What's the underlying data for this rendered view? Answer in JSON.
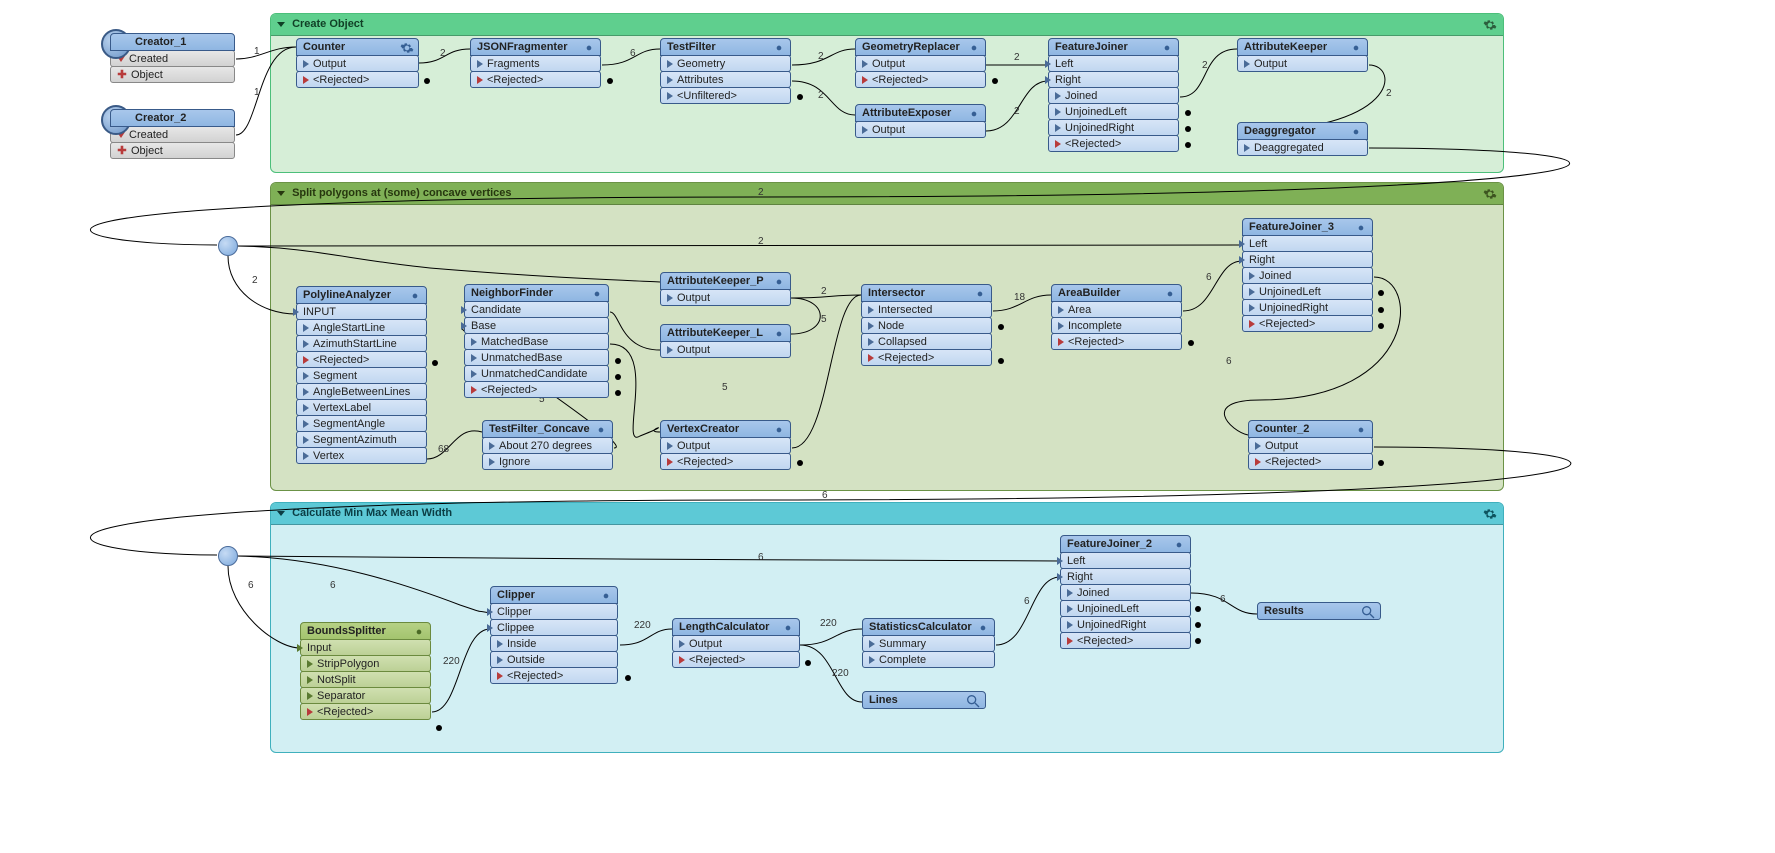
{
  "bookmarks": {
    "create": {
      "title": "Create Object"
    },
    "split": {
      "title": "Split polygons at (some) concave vertices"
    },
    "calc": {
      "title": "Calculate Min Max Mean Width"
    }
  },
  "readers": {
    "c1": {
      "name": "Creator_1",
      "p1": "Created",
      "p2": "Object"
    },
    "c2": {
      "name": "Creator_2",
      "p1": "Created",
      "p2": "Object"
    }
  },
  "nodes": {
    "counter": {
      "title": "Counter",
      "ports": [
        "Output",
        "<Rejected>"
      ]
    },
    "jsonfrag": {
      "title": "JSONFragmenter",
      "ports": [
        "Fragments",
        "<Rejected>"
      ]
    },
    "testfilter": {
      "title": "TestFilter",
      "ports": [
        "Geometry",
        "Attributes",
        "<Unfiltered>"
      ]
    },
    "georeplacer": {
      "title": "GeometryReplacer",
      "ports": [
        "Output",
        "<Rejected>"
      ]
    },
    "attrexposer": {
      "title": "AttributeExposer",
      "ports": [
        "Output"
      ]
    },
    "fjoin": {
      "title": "FeatureJoiner",
      "inports": [
        "Left",
        "Right"
      ],
      "ports": [
        "Joined",
        "UnjoinedLeft",
        "UnjoinedRight",
        "<Rejected>"
      ]
    },
    "attrkeeper": {
      "title": "AttributeKeeper",
      "ports": [
        "Output"
      ]
    },
    "deagg": {
      "title": "Deaggregator",
      "ports": [
        "Deaggregated"
      ]
    },
    "polyline": {
      "title": "PolylineAnalyzer",
      "in": "INPUT",
      "ports": [
        "AngleStartLine",
        "AzimuthStartLine",
        "<Rejected>",
        "Segment",
        "AngleBetweenLines",
        "VertexLabel",
        "SegmentAngle",
        "SegmentAzimuth",
        "Vertex"
      ]
    },
    "tfconcave": {
      "title": "TestFilter_Concave",
      "ports": [
        "About 270 degrees",
        "Ignore"
      ]
    },
    "neighbor": {
      "title": "NeighborFinder",
      "in": [
        "Candidate",
        "Base"
      ],
      "ports": [
        "MatchedBase",
        "UnmatchedBase",
        "UnmatchedCandidate",
        "<Rejected>"
      ]
    },
    "akp": {
      "title": "AttributeKeeper_P",
      "ports": [
        "Output"
      ]
    },
    "akl": {
      "title": "AttributeKeeper_L",
      "ports": [
        "Output"
      ]
    },
    "vcreator": {
      "title": "VertexCreator",
      "ports": [
        "Output",
        "<Rejected>"
      ]
    },
    "intersector": {
      "title": "Intersector",
      "ports": [
        "Intersected",
        "Node",
        "Collapsed",
        "<Rejected>"
      ]
    },
    "areabuilder": {
      "title": "AreaBuilder",
      "ports": [
        "Area",
        "Incomplete",
        "<Rejected>"
      ]
    },
    "fjoin3": {
      "title": "FeatureJoiner_3",
      "inports": [
        "Left",
        "Right"
      ],
      "ports": [
        "Joined",
        "UnjoinedLeft",
        "UnjoinedRight",
        "<Rejected>"
      ]
    },
    "counter2": {
      "title": "Counter_2",
      "ports": [
        "Output",
        "<Rejected>"
      ]
    },
    "bsplitter": {
      "title": "BoundsSplitter",
      "in": "Input",
      "ports": [
        "StripPolygon",
        "NotSplit",
        "Separator",
        "<Rejected>"
      ]
    },
    "clipper": {
      "title": "Clipper",
      "in": [
        "Clipper",
        "Clippee"
      ],
      "ports": [
        "Inside",
        "Outside",
        "<Rejected>"
      ]
    },
    "lengthcalc": {
      "title": "LengthCalculator",
      "ports": [
        "Output",
        "<Rejected>"
      ]
    },
    "statscalc": {
      "title": "StatisticsCalculator",
      "ports": [
        "Summary",
        "Complete"
      ]
    },
    "fjoin2": {
      "title": "FeatureJoiner_2",
      "inports": [
        "Left",
        "Right"
      ],
      "ports": [
        "Joined",
        "UnjoinedLeft",
        "UnjoinedRight",
        "<Rejected>"
      ]
    },
    "lines": {
      "title": "Lines"
    },
    "results": {
      "title": "Results"
    }
  },
  "edges": {
    "e1": "1",
    "e2": "1",
    "e3": "2",
    "e4": "6",
    "e5": "2",
    "e6": "2",
    "e7": "2",
    "e8": "2",
    "e9": "2",
    "e10": "2",
    "e11": "2",
    "e12": "2",
    "e13": "2",
    "e14": "68",
    "e15": "5",
    "e16": "5",
    "e17": "2",
    "e18": "5",
    "e19": "18",
    "e20": "6",
    "e21": "6",
    "e22": "6",
    "e23": "6",
    "e24": "6",
    "e25": "6",
    "e26": "220",
    "e27": "220",
    "e28": "220",
    "e29": "220",
    "e30": "6",
    "e31": "6"
  }
}
